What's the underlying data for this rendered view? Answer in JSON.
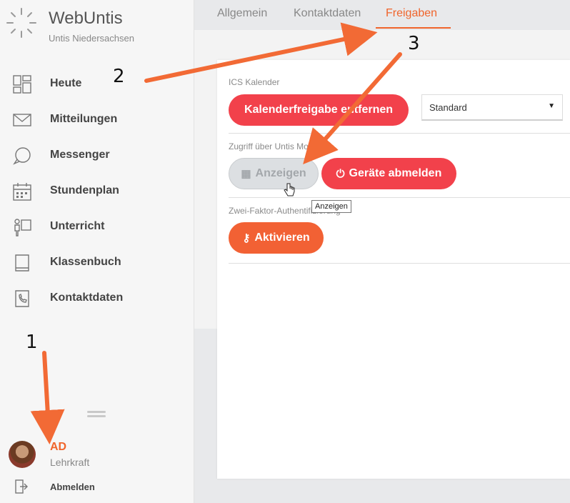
{
  "brand": {
    "title": "WebUntis",
    "subtitle": "Untis Niedersachsen"
  },
  "sidebar": {
    "items": [
      {
        "label": "Heute",
        "icon": "dashboard-icon"
      },
      {
        "label": "Mitteilungen",
        "icon": "envelope-icon"
      },
      {
        "label": "Messenger",
        "icon": "chat-bubble-icon"
      },
      {
        "label": "Stundenplan",
        "icon": "calendar-icon"
      },
      {
        "label": "Unterricht",
        "icon": "teacher-board-icon"
      },
      {
        "label": "Klassenbuch",
        "icon": "book-icon"
      },
      {
        "label": "Kontaktdaten",
        "icon": "contact-book-icon"
      }
    ]
  },
  "user": {
    "name": "AD",
    "role": "Lehrkraft",
    "logout": "Abmelden"
  },
  "tabs": [
    {
      "label": "Allgemein",
      "active": false
    },
    {
      "label": "Kontaktdaten",
      "active": false
    },
    {
      "label": "Freigaben",
      "active": true
    }
  ],
  "ics": {
    "label": "ICS Kalender",
    "button": "Kalenderfreigabe entfernen",
    "select_value": "Standard"
  },
  "mobile": {
    "label": "Zugriff über Untis Mobile",
    "show_button": "Anzeigen",
    "logout_devices_button": "Geräte abmelden",
    "tooltip": "Anzeigen"
  },
  "twofactor": {
    "label": "Zwei-Faktor-Authentifizierung",
    "button": "Aktivieren"
  },
  "annotations": {
    "one": "1",
    "two": "2",
    "three": "3"
  },
  "colors": {
    "accent": "#f0652c",
    "red": "#f2414b",
    "orange": "#f26134",
    "arrow": "#f26a35"
  }
}
